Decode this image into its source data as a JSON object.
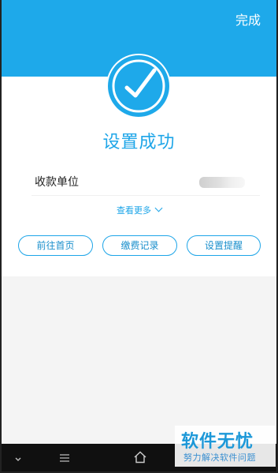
{
  "header": {
    "done_label": "完成",
    "accent_color": "#1ea9ea"
  },
  "result": {
    "icon": "check-circle-icon",
    "title": "设置成功",
    "payee_label": "收款单位",
    "payee_value": "",
    "more_label": "查看更多"
  },
  "actions": {
    "home_label": "前往首页",
    "records_label": "缴费记录",
    "reminder_label": "设置提醒"
  },
  "nav": {
    "icons": [
      "chevron-down-icon",
      "menu-icon",
      "home-icon"
    ]
  },
  "watermark": {
    "title": "软件无忧",
    "subtitle": "努力解决软件问题"
  }
}
